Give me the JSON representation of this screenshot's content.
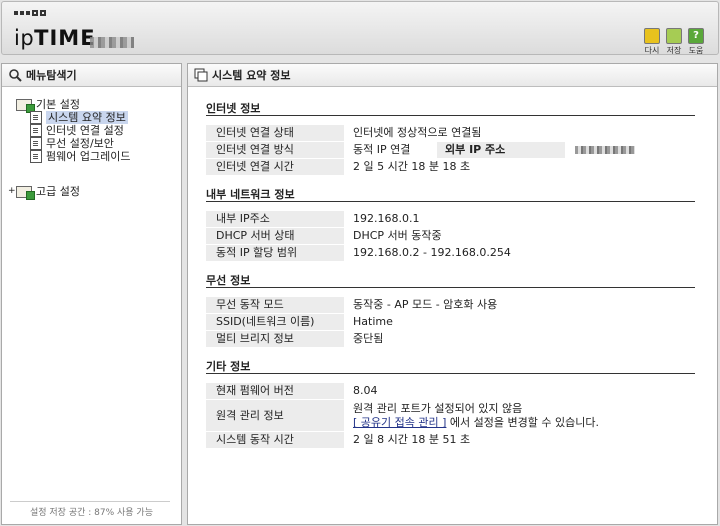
{
  "header": {
    "brand_prefix": "ip",
    "brand_bold": "TIME",
    "buttons": [
      {
        "label": "다시",
        "icon": "refresh-icon",
        "color": "#e0b400"
      },
      {
        "label": "저장",
        "icon": "save-icon",
        "color": "#8bbe3c"
      },
      {
        "label": "도움",
        "icon": "help-icon",
        "color": "#5aa83a"
      }
    ]
  },
  "sidebar": {
    "title": "메뉴탐색기",
    "groups": [
      {
        "label": "기본 설정",
        "items": [
          "시스템 요약 정보",
          "인터넷 연결 설정",
          "무선 설정/보안",
          "펌웨어 업그레이드"
        ]
      },
      {
        "label": "고급 설정"
      }
    ],
    "storage": "설정 저장 공간 : 87% 사용 가능"
  },
  "main": {
    "title": "시스템 요약 정보",
    "internet": {
      "title": "인터넷 정보",
      "rows": [
        {
          "k": "인터넷 연결 상태",
          "v": "인터넷에 정상적으로 연결됨"
        },
        {
          "k": "인터넷 연결 방식",
          "v": "동적 IP 연결",
          "extra_label": "외부 IP 주소"
        },
        {
          "k": "인터넷 연결 시간",
          "v": "2 일 5 시간 18 분 18 초"
        }
      ]
    },
    "lan": {
      "title": "내부 네트워크 정보",
      "rows": [
        {
          "k": "내부 IP주소",
          "v": "192.168.0.1"
        },
        {
          "k": "DHCP 서버 상태",
          "v": "DHCP 서버 동작중"
        },
        {
          "k": "동적 IP 할당 범위",
          "v": "192.168.0.2 - 192.168.0.254"
        }
      ]
    },
    "wireless": {
      "title": "무선 정보",
      "rows": [
        {
          "k": "무선 동작 모드",
          "v": "동작중 - AP 모드 - 암호화 사용"
        },
        {
          "k": "SSID(네트워크 이름)",
          "v": "Hatime"
        },
        {
          "k": "멀티 브리지 정보",
          "v": "중단됨"
        }
      ]
    },
    "other": {
      "title": "기타 정보",
      "firmware_k": "현재 펌웨어 버전",
      "firmware_v": "8.04",
      "remote_k": "원격 관리 정보",
      "remote_line1": "원격 관리 포트가 설정되어 있지 않음",
      "remote_link": "[ 공유기 접속 관리 ]",
      "remote_line2": " 에서 설정을 변경할 수 있습니다.",
      "uptime_k": "시스템 동작 시간",
      "uptime_v": "2 일 8 시간 18 분 51 초"
    }
  }
}
